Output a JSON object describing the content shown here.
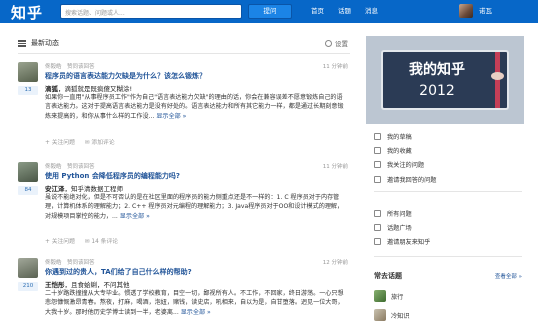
{
  "topbar": {
    "logo": "知乎",
    "search_placeholder": "搜索话题、问题或人...",
    "ask_label": "提问",
    "nav": [
      "首页",
      "话题",
      "消息"
    ],
    "user_name": "诺瓦"
  },
  "feed": {
    "title": "最新动态",
    "settings_label": "设置",
    "items": [
      {
        "meta": "佟毅皓　赞同该回答",
        "time": "11 分钟前",
        "votes": "13",
        "title": "程序员的语言表达能力欠缺是为什么？该怎么锻炼？",
        "answerer_name": "滴狐",
        "answerer_bio": "，滴狐就是既疯傻又糊涂!",
        "excerpt": "如果你一直用\"从事程序员工作\"作为自己\"语言表达能力欠缺\"的理由的话，你会在兼容误差不愿意锻炼自己的语言表达能力。这对于提高语言表达能力是没有好处的。语言表达能力和所有其它能力一样，都是通过长期刻意锻炼来提高的，和你从事什么样的工作没...",
        "more": "显示全部 »",
        "actions": [
          "+ 关注问题",
          "✉ 添加评论"
        ]
      },
      {
        "meta": "佟毅皓　赞同该回答",
        "time": "11 分钟前",
        "votes": "84",
        "title": "使用 Python 会降低程序员的编程能力吗?",
        "answerer_name": "安江泽",
        "answerer_bio": "，知乎清数据工程师",
        "excerpt": "虽说不能绝对化，但是不可否认的是在社区里面的程序员的能力侧重点还是不一样的：1. C 程序员对于内存管理，计算机体系的理解能力；2. C++ 程序员对元编程的理解能力；3. Java程序员对于OO和设计模式的理解，对规模项目掌控的能力，...",
        "more": "显示全部 »",
        "actions": [
          "+ 关注问题",
          "✉ 14 条评论"
        ]
      },
      {
        "meta": "佟毅皓　赞同该回答",
        "time": "12 分钟前",
        "votes": "210",
        "title": "你遇到过的贵人，TA们给了自己什么样的帮助?",
        "answerer_name": "王恺彤",
        "answerer_bio": "，且食蛤蜊，不问其他",
        "excerpt": "二十岁路跌撞撞从大专毕业。惯透了学校教育，目空一切，鄙视所有人。不工作，不回家，终日游荡。一心只想悲怨慷慨激昂青春。熬夜，打麻，喝酒，泡妞，赌钱，读史店，吼相来，自以为是，自甘堕落。迥见一位大哥，大我十岁。那时他历史学博士读到一半，老婆离...",
        "more": "显示全部 »",
        "actions": []
      }
    ]
  },
  "sidebar": {
    "banner_line1": "我的知乎",
    "banner_line2": "2012",
    "links_group1": [
      "我的草稿",
      "我的收藏",
      "我关注的问题",
      "邀请我回答的问题"
    ],
    "links_group2": [
      "所有问题",
      "话题广场",
      "邀请朋友来知乎"
    ],
    "common_topics_title": "常去话题",
    "see_all": "查看全部 »",
    "topics": [
      "旅行",
      "冷知识"
    ]
  }
}
